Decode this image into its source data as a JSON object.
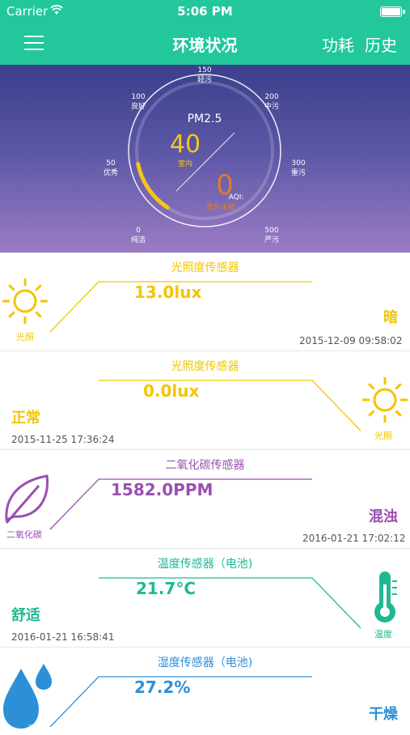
{
  "status_bar": {
    "carrier": "Carrier",
    "time": "5:06 PM"
  },
  "navbar": {
    "title": "环境状况",
    "power_label": "功耗",
    "history_label": "历史"
  },
  "gauge": {
    "center_title": "PM2.5",
    "indoor_value": "40",
    "indoor_label": "室内",
    "aqi_value": "0",
    "aqi_label": "AQI:",
    "aqi_status": "室外未知",
    "ticks": [
      {
        "value": "0",
        "label": "纯洁"
      },
      {
        "value": "50",
        "label": "优秀"
      },
      {
        "value": "100",
        "label": "良好"
      },
      {
        "value": "150",
        "label": "轻污"
      },
      {
        "value": "200",
        "label": "中污"
      },
      {
        "value": "300",
        "label": "重污"
      },
      {
        "value": "500",
        "label": "严污"
      }
    ],
    "accent_color": "#f5c518"
  },
  "cards": [
    {
      "title": "光照度传感器",
      "value": "13.0lux",
      "status": "暗",
      "timestamp": "2015-12-09 09:58:02",
      "icon": "sun-icon",
      "icon_label": "光照",
      "color": "#f2c600"
    },
    {
      "title": "光照度传感器",
      "value": "0.0lux",
      "status": "正常",
      "timestamp": "2015-11-25 17:36:24",
      "icon": "sun-icon",
      "icon_label": "光照",
      "color": "#f2c600"
    },
    {
      "title": "二氧化碳传感器",
      "value": "1582.0PPM",
      "status": "混浊",
      "timestamp": "2016-01-21 17:02:12",
      "icon": "leaf-icon",
      "icon_label": "二氧化碳",
      "color": "#9b4fb0"
    },
    {
      "title": "温度传感器（电池)",
      "value": "21.7°C",
      "status": "舒适",
      "timestamp": "2016-01-21 16:58:41",
      "icon": "thermometer-icon",
      "icon_label": "温度",
      "color": "#1fb894"
    },
    {
      "title": "湿度传感器（电池)",
      "value": "27.2%",
      "status": "干燥",
      "timestamp": "",
      "icon": "water-drop-icon",
      "icon_label": "湿度",
      "color": "#2d8fd8"
    }
  ]
}
